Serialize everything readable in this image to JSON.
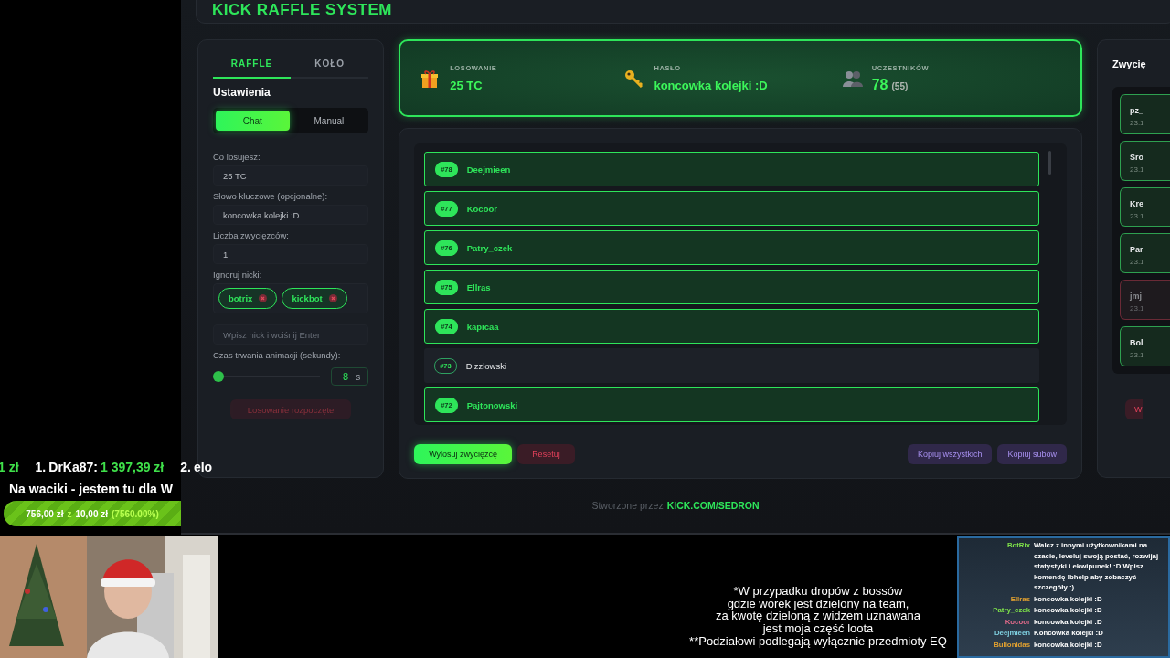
{
  "ticker": {
    "items": [
      {
        "amount": "1 zł"
      },
      {
        "rank": "1.",
        "name": "DrKa87:",
        "amount": "1 397,39 zł"
      },
      {
        "rank": "2.",
        "name": "elo"
      }
    ]
  },
  "goal": {
    "title": "Na waciki - jestem tu dla W",
    "current": "756,00 zł",
    "separator": "z",
    "target": "10,00 zł",
    "percent": "(7560.00%)",
    "level": 1
  },
  "app": {
    "title": "KICK RAFFLE SYSTEM",
    "tabs": [
      {
        "label": "RAFFLE",
        "selected": true
      },
      {
        "label": "KOŁO",
        "selected": false
      }
    ],
    "settings": {
      "heading": "Ustawienia",
      "modes": [
        {
          "label": "Chat",
          "selected": true
        },
        {
          "label": "Manual",
          "selected": false
        }
      ],
      "prize_label": "Co losujesz:",
      "prize": "25 TC",
      "keyword_label": "Słowo kluczowe (opcjonalne):",
      "keyword": "koncowka kolejki :D",
      "winners_label": "Liczba zwycięzców:",
      "winners": "1",
      "ignore_label": "Ignoruj nicki:",
      "ignored": [
        "botrix",
        "kickbot"
      ],
      "ignore_placeholder": "Wpisz nick i wciśnij Enter",
      "duration_label": "Czas trwania animacji (sekundy):",
      "duration": {
        "level": 0.05,
        "value": "8",
        "unit": "s"
      },
      "start_button": {
        "label": "Losowanie rozpoczęte",
        "disabled": true
      }
    },
    "stats": [
      {
        "kind": "gift",
        "label": "LOSOWANIE",
        "value": "25 TC"
      },
      {
        "kind": "key",
        "label": "HASŁO",
        "value": "koncowka kolejki :D"
      },
      {
        "kind": "people",
        "label": "UCZESTNIKÓW",
        "value": "78",
        "extra": "(55)"
      }
    ],
    "participants": [
      {
        "number": "#78",
        "name": "Deejmieen",
        "highlighted": true
      },
      {
        "number": "#77",
        "name": "Kocoor",
        "highlighted": true
      },
      {
        "number": "#76",
        "name": "Patry_czek",
        "highlighted": true
      },
      {
        "number": "#75",
        "name": "Ellras",
        "highlighted": true
      },
      {
        "number": "#74",
        "name": "kapicaa",
        "highlighted": true
      },
      {
        "number": "#73",
        "name": "Dizzlowski",
        "highlighted": false
      },
      {
        "number": "#72",
        "name": "Pajtonowski",
        "highlighted": true
      }
    ],
    "actions": [
      {
        "kind": "primary",
        "label": "Wylosuj zwycięzcę"
      },
      {
        "kind": "danger",
        "label": "Resetuj"
      },
      {
        "kind": "spacer"
      },
      {
        "kind": "purple",
        "label": "Kopiuj wszystkich"
      },
      {
        "kind": "purple",
        "label": "Kopiuj subów"
      }
    ],
    "winners_panel": {
      "title": "Zwycię",
      "winners": [
        {
          "name": "pz_",
          "date": "23.1",
          "valid": true
        },
        {
          "name": "Sro",
          "date": "23.1",
          "valid": true
        },
        {
          "name": "Kre",
          "date": "23.1",
          "valid": true
        },
        {
          "name": "Par",
          "date": "23.1",
          "valid": true
        },
        {
          "name": "jmj",
          "date": "23.1",
          "valid": false
        },
        {
          "name": "Bol",
          "date": "23.1",
          "valid": true
        }
      ],
      "button": "W"
    },
    "footer": {
      "text": "Stworzone przez",
      "link": "KICK.COM/SEDRON"
    }
  },
  "webcam": {
    "kind": "picture"
  },
  "caption": [
    "*W przypadku dropów z bossów",
    "gdzie worek jest dzielony na team,",
    "za kwotę dzieloną z widzem uznawana",
    "jest moja część loota",
    "**Podziałowi podlegają wyłącznie przedmioty EQ"
  ],
  "chat": [
    {
      "user": "BotRix",
      "color": "#7ee04a",
      "message": "Walcz z innymi użytkownikami na czacie, leveluj swoją postać, rozwijaj statystyki i ekwipunek! :D Wpisz komendę !bhelp aby zobaczyć szczegóły :)"
    },
    {
      "user": "Ellras",
      "color": "#e0a030",
      "message": "koncowka kolejki :D"
    },
    {
      "user": "Patry_czek",
      "color": "#7ee04a",
      "message": "koncowka kolejki :D"
    },
    {
      "user": "Kocoor",
      "color": "#e06a8a",
      "message": "koncowka kolejki :D"
    },
    {
      "user": "Deejmieen",
      "color": "#7fd0e0",
      "message": "Koncowka kolejki :D"
    },
    {
      "user": "Bulionidas",
      "color": "#e0a030",
      "message": "koncowka kolejki :D"
    }
  ]
}
